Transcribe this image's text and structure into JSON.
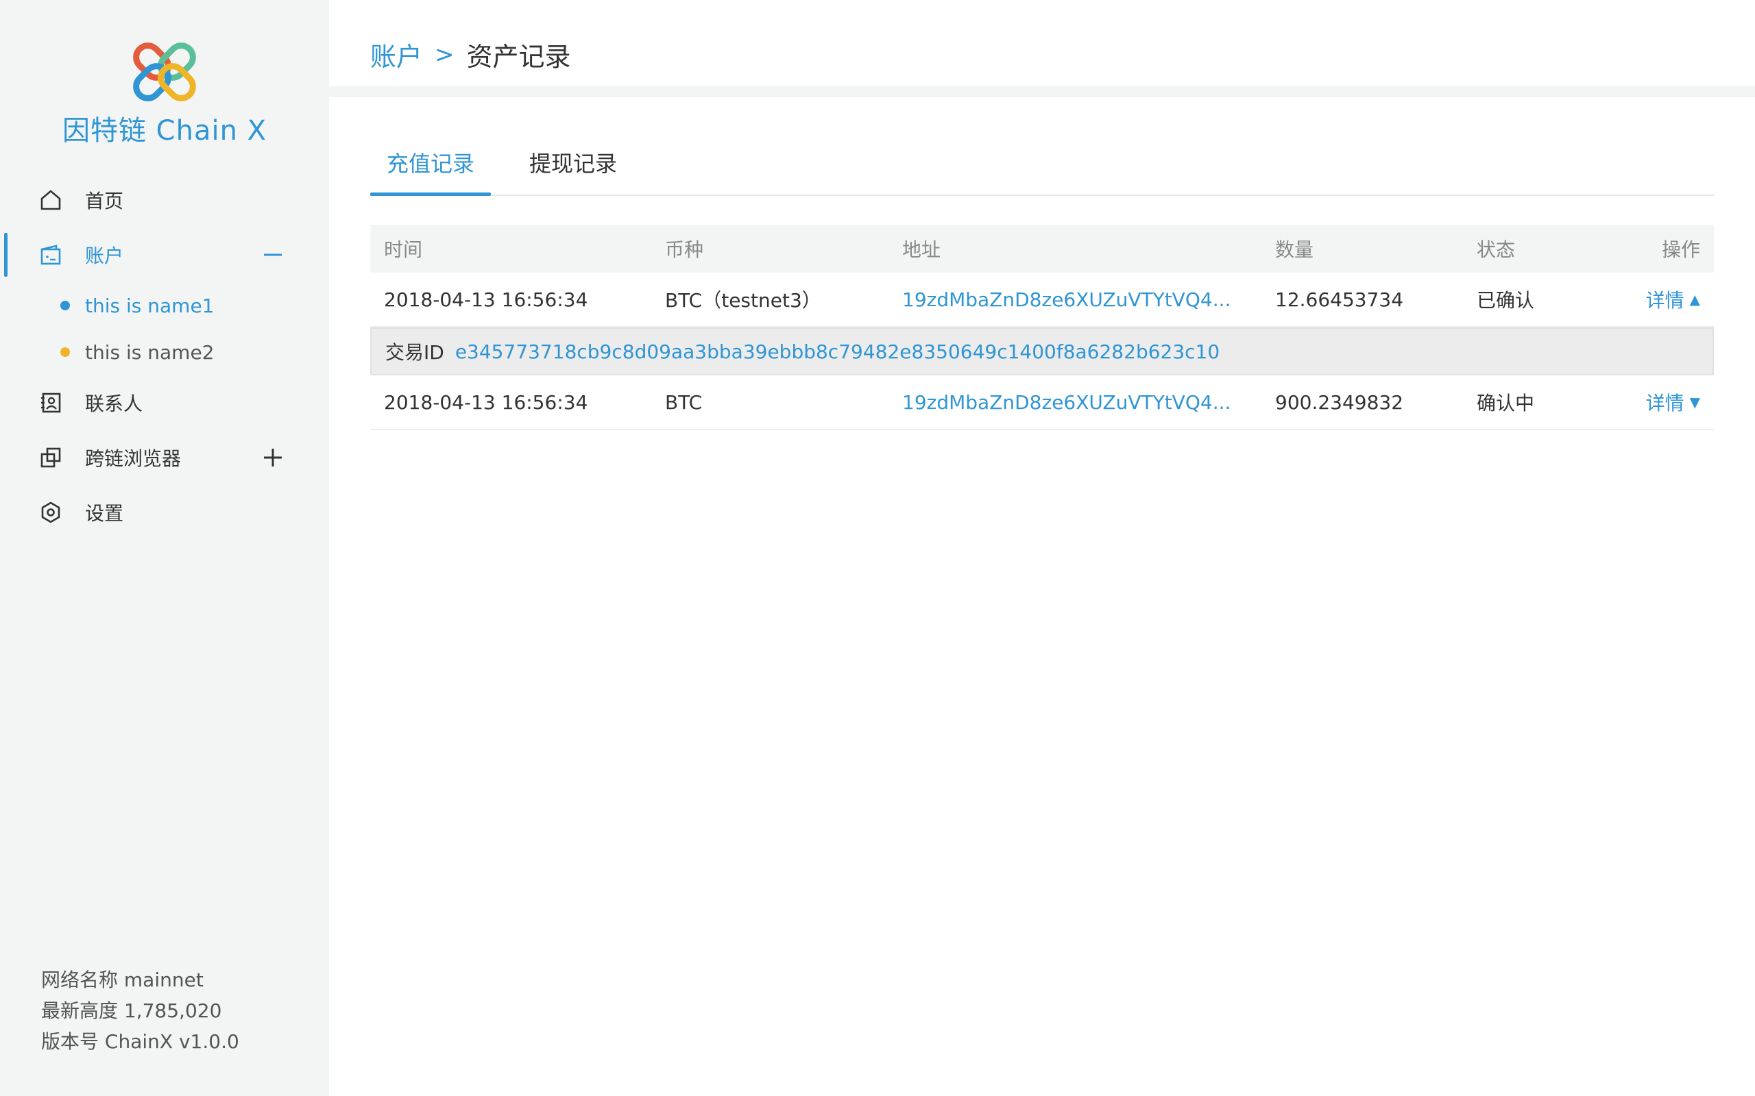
{
  "app": {
    "logo_text": "因特链 Chain X",
    "brand_color": "#2f95d4"
  },
  "sidebar": {
    "items": [
      {
        "label": "首页",
        "icon": "home-icon"
      },
      {
        "label": "账户",
        "icon": "wallet-icon",
        "toggle": "collapse-minus-icon",
        "active": true
      },
      {
        "label": "联系人",
        "icon": "contacts-icon"
      },
      {
        "label": "跨链浏览器",
        "icon": "cross-chain-icon",
        "toggle": "expand-plus-icon"
      },
      {
        "label": "设置",
        "icon": "settings-icon"
      }
    ],
    "accounts": [
      {
        "label": "this is name1",
        "dot_color": "#2f95d4",
        "active": true
      },
      {
        "label": "this is name2",
        "dot_color": "#f0b429",
        "active": false
      }
    ],
    "network": {
      "name": "网络名称 mainnet",
      "height": "最新高度 1,785,020",
      "version": "版本号 ChainX v1.0.0"
    }
  },
  "header": {
    "breadcrumb_parent": "账户",
    "breadcrumb_sep": ">",
    "breadcrumb_current": "资产记录"
  },
  "tabs": [
    {
      "label": "充值记录",
      "active": true
    },
    {
      "label": "提现记录",
      "active": false
    }
  ],
  "table": {
    "columns": [
      "时间",
      "币种",
      "地址",
      "数量",
      "状态",
      "操作"
    ],
    "rows": [
      {
        "time": "2018-04-13 16:56:34",
        "coin": "BTC（testnet3）",
        "address": "19zdMbaZnD8ze6XUZuVTYtVQ4...",
        "amount": "12.66453734",
        "status": "已确认",
        "action": "详情",
        "caret": "▲",
        "expanded": true
      },
      {
        "time": "2018-04-13 16:56:34",
        "coin": "BTC",
        "address": "19zdMbaZnD8ze6XUZuVTYtVQ4...",
        "amount": "900.2349832",
        "status": "确认中",
        "action": "详情",
        "caret": "▼",
        "expanded": false
      }
    ],
    "txid_label": "交易ID",
    "txid_value": "e345773718cb9c8d09aa3bba39ebbb8c79482e8350649c1400f8a6282b623c10"
  }
}
